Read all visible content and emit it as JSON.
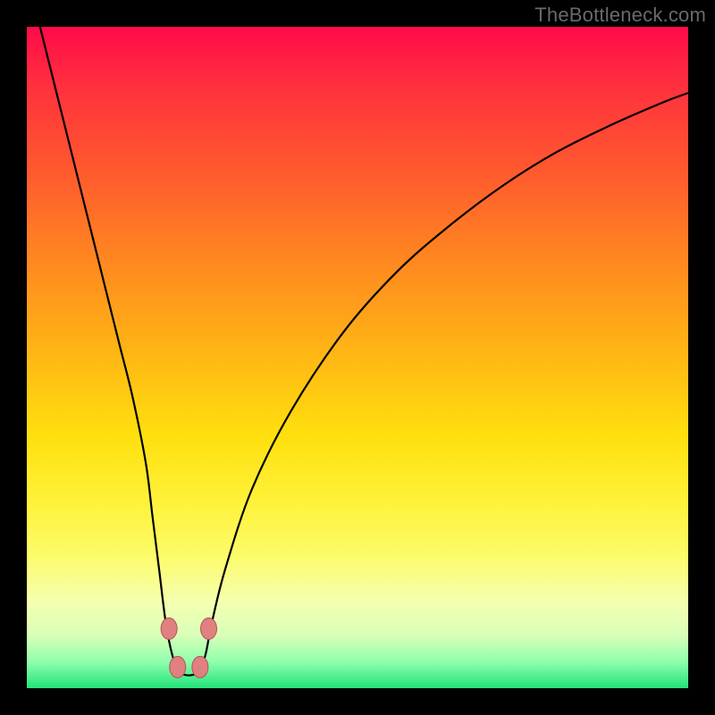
{
  "watermark": "TheBottleneck.com",
  "chart_data": {
    "type": "line",
    "title": "",
    "xlabel": "",
    "ylabel": "",
    "xlim": [
      0,
      100
    ],
    "ylim": [
      0,
      100
    ],
    "grid": false,
    "curve": {
      "x": [
        2,
        4,
        6,
        8,
        10,
        12,
        14,
        16,
        18,
        19,
        20,
        21,
        22,
        23,
        24,
        25,
        26,
        27,
        28,
        30,
        34,
        40,
        48,
        56,
        64,
        72,
        80,
        88,
        96,
        100
      ],
      "y": [
        100,
        92,
        84,
        76,
        68,
        60,
        52,
        44,
        34,
        26,
        18,
        10,
        5,
        2.5,
        2,
        2,
        2.5,
        5,
        10,
        18,
        30,
        42,
        54,
        63,
        70,
        76,
        81,
        85,
        88.5,
        90
      ]
    },
    "markers": {
      "x": [
        21.5,
        22.8,
        26.2,
        27.5
      ],
      "y": [
        9,
        3.2,
        3.2,
        9
      ]
    },
    "background_gradient": {
      "top": "#ff0a4a",
      "upper_mid": "#ff8a1f",
      "mid": "#ffe00e",
      "lower_mid": "#f5ffb0",
      "bottom": "#22e27a"
    }
  }
}
